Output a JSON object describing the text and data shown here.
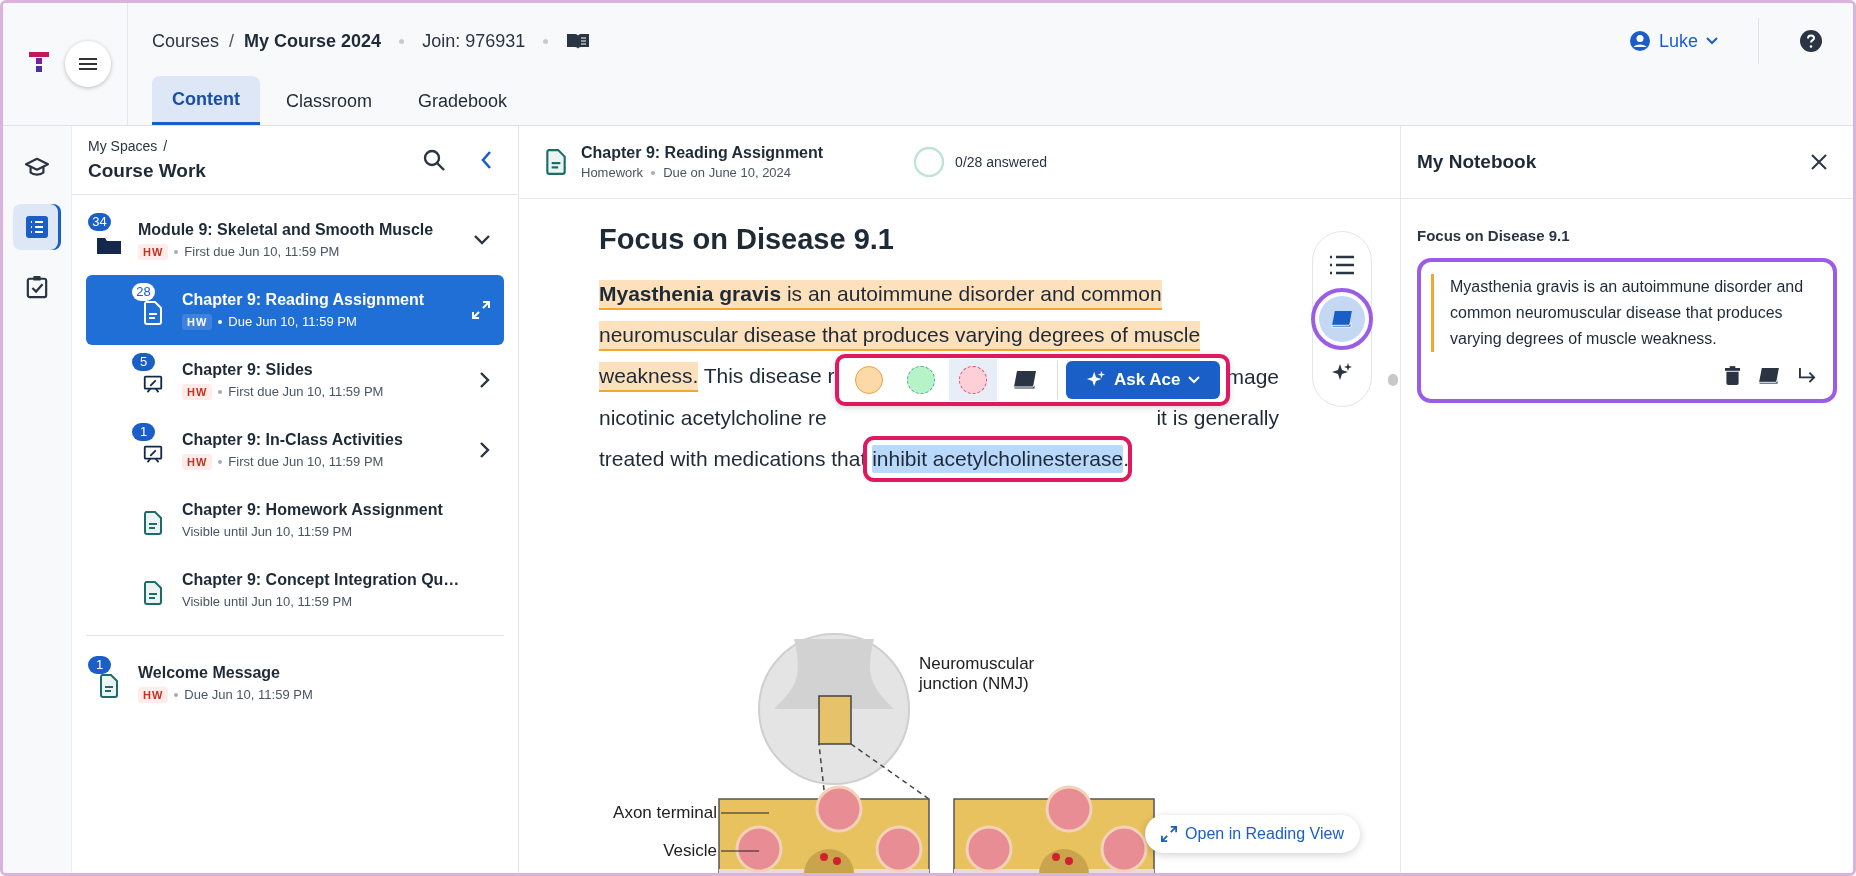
{
  "header": {
    "breadcrumb": [
      {
        "label": "Courses",
        "current": false
      },
      {
        "label": "My Course 2024",
        "current": true
      }
    ],
    "separator": "/",
    "join": "Join: 976931",
    "user": "Luke"
  },
  "tabs": [
    {
      "label": "Content",
      "selected": true
    },
    {
      "label": "Classroom",
      "selected": false
    },
    {
      "label": "Gradebook",
      "selected": false
    }
  ],
  "rail": [
    {
      "kind": "cap",
      "selected": false
    },
    {
      "kind": "list",
      "selected": true
    },
    {
      "kind": "clipboard",
      "selected": false
    }
  ],
  "sidebar": {
    "crumb": "My Spaces",
    "crumb_separator": "/",
    "title": "Course Work",
    "items": [
      {
        "kind": "module",
        "badge": "34",
        "title": "Module 9: Skeletal and Smooth Muscle",
        "tag": "HW",
        "due": "First due Jun 10, 11:59 PM",
        "selected": false,
        "expanded": true,
        "children": [
          {
            "kind": "reading",
            "badge": "28",
            "title": "Chapter 9: Reading Assignment",
            "tag": "HW",
            "due": "Due Jun 10, 11:59 PM",
            "selected": true,
            "trailing": {
              "kind": "expand"
            }
          },
          {
            "kind": "slides",
            "badge": "5",
            "title": "Chapter 9: Slides",
            "tag": "HW",
            "due": "First due Jun 10, 11:59 PM",
            "selected": false,
            "trailing": {
              "kind": "open"
            }
          },
          {
            "kind": "slides",
            "badge": "1",
            "title": "Chapter 9: In-Class Activities",
            "tag": "HW",
            "due": "First due Jun 10, 11:59 PM",
            "selected": false,
            "trailing": {
              "kind": "open"
            }
          },
          {
            "kind": "document",
            "title": "Chapter 9: Homework Assignment",
            "due": "Visible until Jun 10, 11:59 PM",
            "selected": false
          },
          {
            "kind": "document",
            "title": "Chapter 9: Concept Integration Qu…",
            "due": "Visible until Jun 10, 11:59 PM",
            "selected": false
          }
        ]
      },
      {
        "kind": "message",
        "badge": "1",
        "title": "Welcome Message",
        "tag": "HW",
        "due": "Due Jun 10, 11:59 PM",
        "selected": false
      }
    ]
  },
  "reader": {
    "title": "Chapter 9: Reading Assignment",
    "type": "Homework",
    "due": "Due on June 10, 2024",
    "progress": {
      "label": "0/28 answered"
    },
    "heading": "Focus on Disease 9.1",
    "lines": [
      {
        "left": [
          {
            "text": "**Myasthenia gravis** is an autoimmune disorder and common",
            "highlighted": true,
            "selected": false
          }
        ]
      },
      {
        "left": [
          {
            "text": "neuromuscular disease that produces varying degrees of muscle",
            "highlighted": true,
            "selected": false
          }
        ]
      },
      {
        "left": [
          {
            "text": "weakness.",
            "highlighted": true,
            "selected": false
          },
          {
            "text": " This disease r",
            "highlighted": false,
            "selected": false
          }
        ],
        "right": [
          {
            "text": "mage",
            "highlighted": false,
            "selected": false
          }
        ]
      },
      {
        "left": [
          {
            "text": "nicotinic acetylcholine re",
            "highlighted": false,
            "selected": false
          }
        ],
        "right": [
          {
            "text": "it is generally",
            "highlighted": false,
            "selected": false
          }
        ]
      },
      {
        "left": [
          {
            "text": "treated with medications that ",
            "highlighted": false,
            "selected": false
          },
          {
            "text": "inhibit acetylcholinesterase",
            "highlighted": false,
            "selected": true
          },
          {
            "text": ".",
            "highlighted": false,
            "selected": false
          }
        ]
      }
    ],
    "toolbar": {
      "swatches": [
        {
          "color": "#fdd9a8",
          "selected": false
        },
        {
          "color": "#b6f3c6",
          "selected": false
        },
        {
          "color": "#fcd0d6",
          "selected": true
        }
      ],
      "ask": "Ask Ace"
    },
    "tools": [
      {
        "kind": "contents",
        "selected": false
      },
      {
        "kind": "notebook",
        "selected": true
      },
      {
        "kind": "sparkle",
        "selected": false
      }
    ],
    "figure": {
      "title_lines": [
        "Neuromuscular",
        "junction (NMJ)"
      ],
      "labels": [
        "Axon terminal",
        "Vesicle"
      ]
    },
    "reading_view": "Open in Reading View"
  },
  "notebook": {
    "title": "My Notebook",
    "section": "Focus on Disease 9.1",
    "notes": [
      {
        "text": "Myasthenia gravis is an autoimmune disorder and common neuromuscular disease that produces varying degrees of muscle weakness.",
        "color": "#f5a531"
      }
    ]
  }
}
